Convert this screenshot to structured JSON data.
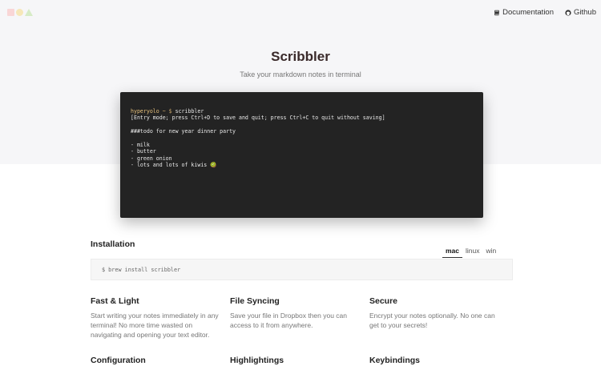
{
  "header": {
    "nav": [
      {
        "label": "Documentation",
        "icon": "book-icon"
      },
      {
        "label": "Github",
        "icon": "github-icon"
      }
    ]
  },
  "hero": {
    "title": "Scribbler",
    "subtitle": "Take your markdown notes in terminal"
  },
  "terminal": {
    "prompt_user": "hyperyolo",
    "prompt_path": " ~ $ ",
    "command": "scribbler",
    "lines": [
      "[Entry mode; press Ctrl+D to save and quit; press Ctrl+C to quit without saving]",
      "",
      "###todo for new year dinner party",
      "",
      "- milk",
      "- butter",
      "- green onion",
      "- lots and lots of kiwis 🥝"
    ]
  },
  "installation": {
    "title": "Installation",
    "tabs": [
      {
        "label": "mac",
        "active": true
      },
      {
        "label": "linux",
        "active": false
      },
      {
        "label": "win",
        "active": false
      }
    ],
    "command": "$ brew install scribbler"
  },
  "features": [
    {
      "title": "Fast & Light",
      "desc": "Start writing your notes immediately in any terminal! No more time wasted on navigating and opening your text editor."
    },
    {
      "title": "File Syncing",
      "desc": "Save your file in Dropbox then you can access to it from anywhere."
    },
    {
      "title": "Secure",
      "desc": "Encrypt your notes optionally. No one can get to your secrets!"
    },
    {
      "title": "Configuration",
      "desc": ""
    },
    {
      "title": "Highlightings",
      "desc": ""
    },
    {
      "title": "Keybindings",
      "desc": ""
    }
  ],
  "colors": {
    "logo_square": "#f9d6d6",
    "logo_circle": "#f6e7b8",
    "logo_triangle": "#d6ebc6",
    "terminal_bg": "#232323",
    "hero_bg": "#f6f6f8"
  }
}
